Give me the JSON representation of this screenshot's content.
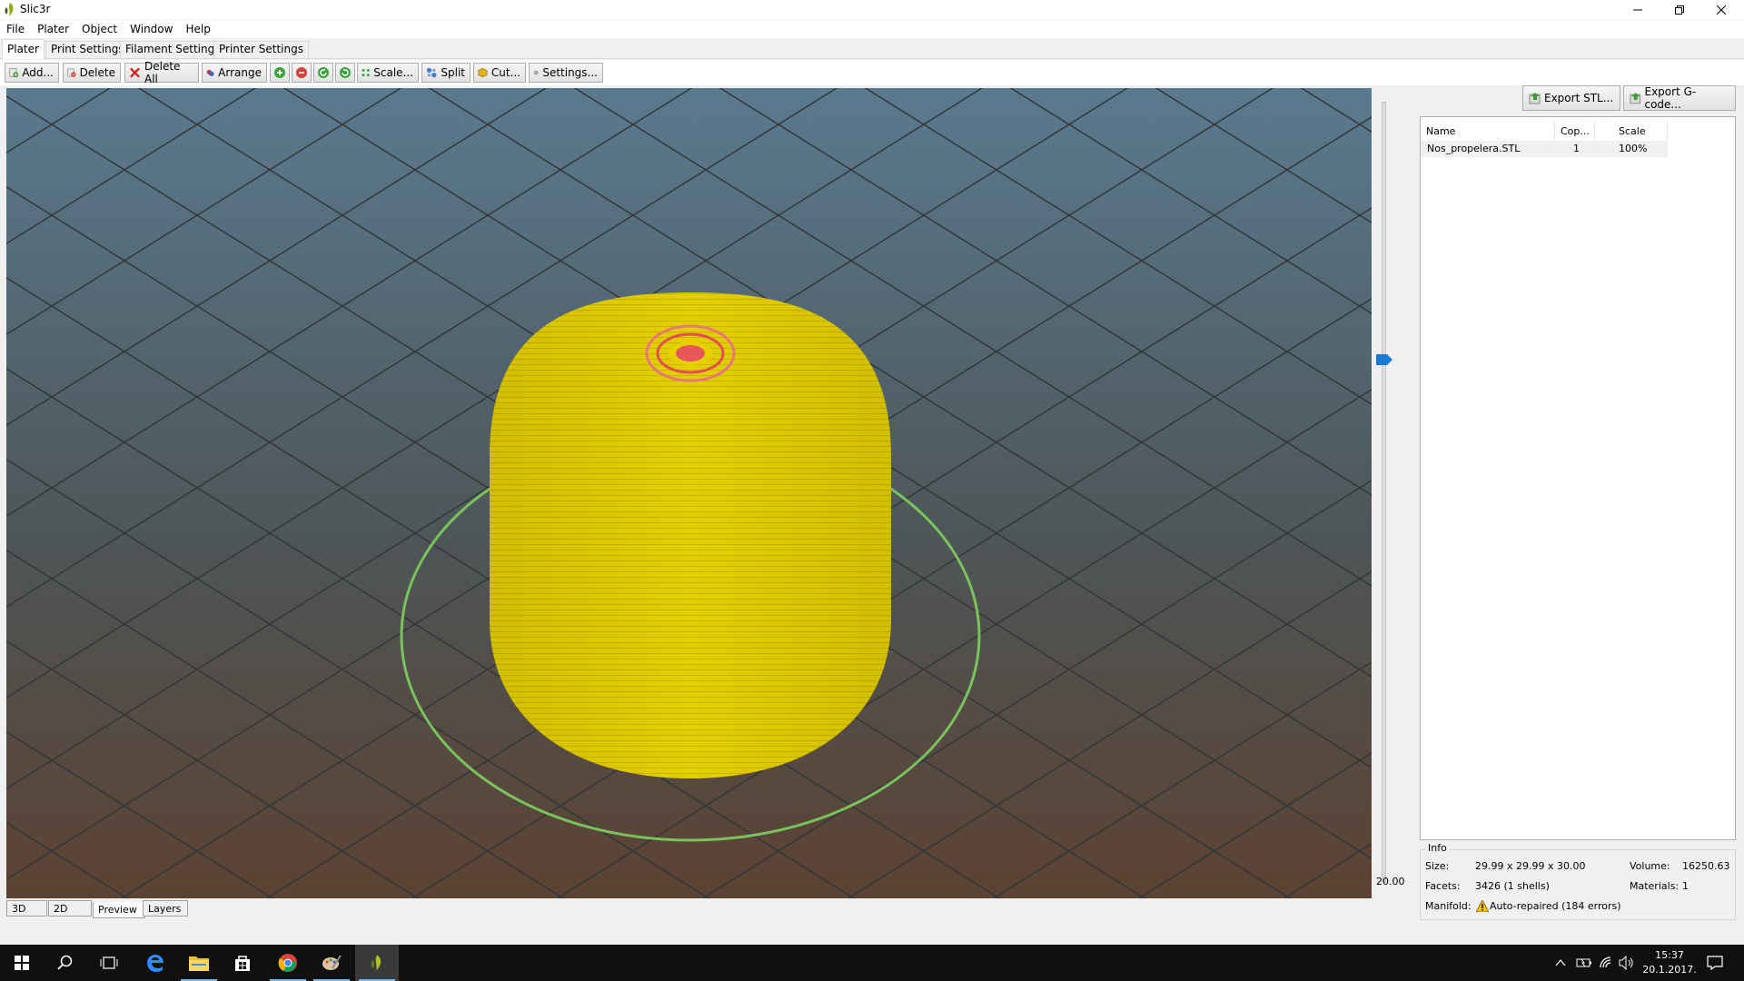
{
  "window": {
    "title": "Slic3r",
    "minimize_icon": "minimize-icon",
    "maximize_icon": "restore-icon",
    "close_icon": "close-icon"
  },
  "menu": [
    "File",
    "Plater",
    "Object",
    "Window",
    "Help"
  ],
  "tabs": [
    "Plater",
    "Print Settings",
    "Filament Settings",
    "Printer Settings"
  ],
  "toolbar": {
    "add": "Add...",
    "delete": "Delete",
    "delete_all": "Delete All",
    "arrange": "Arrange",
    "scale": "Scale...",
    "split": "Split",
    "cut": "Cut...",
    "settings": "Settings..."
  },
  "layer_slider": {
    "value": "20.00"
  },
  "export": {
    "stl": "Export STL...",
    "gcode": "Export G-code..."
  },
  "object_list": {
    "columns": [
      "Name",
      "Cop...",
      "Scale"
    ],
    "rows": [
      {
        "name": "Nos_propelera.STL",
        "copies": "1",
        "scale": "100%"
      }
    ]
  },
  "info": {
    "legend": "Info",
    "size_label": "Size:",
    "size_value": "29.99 x 29.99 x 30.00",
    "volume_label": "Volume:",
    "volume_value": "16250.63",
    "facets_label": "Facets:",
    "facets_value": "3426 (1 shells)",
    "materials_label": "Materials:",
    "materials_value": "1",
    "manifold_label": "Manifold:",
    "manifold_value": "Auto-repaired (184 errors)"
  },
  "view_tabs": [
    "3D",
    "2D",
    "Preview",
    "Layers"
  ],
  "taskbar": {
    "time": "15:37",
    "date": "20.1.2017."
  },
  "colors": {
    "model": "#e8d000",
    "bed_circle": "#7ac25c",
    "highlight": "#e8585a",
    "slider_thumb": "#1a7ad4"
  }
}
